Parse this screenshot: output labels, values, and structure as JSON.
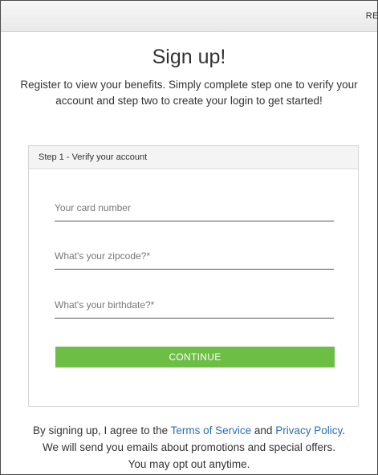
{
  "topbar": {
    "link_label": "RE"
  },
  "page": {
    "title": "Sign up!",
    "subtitle": "Register to view your benefits. Simply complete step one to verify your account and step two to create your login to get started!"
  },
  "step1": {
    "header": "Step 1 - Verify your account",
    "card_number_placeholder": "Your card number",
    "zipcode_placeholder": "What's your zipcode?*",
    "birthdate_placeholder": "What's your birthdate?*",
    "continue_label": "CONTINUE"
  },
  "footer": {
    "text_before": "By signing up, I agree to the ",
    "terms_label": "Terms of Service",
    "and_text": " and ",
    "privacy_label": "Privacy Policy",
    "period": ".",
    "line2": "We will send you emails about promotions and special offers.",
    "line3": "You may opt out anytime."
  },
  "colors": {
    "accent_green": "#6cbe45",
    "link_blue": "#2a6ebb"
  }
}
